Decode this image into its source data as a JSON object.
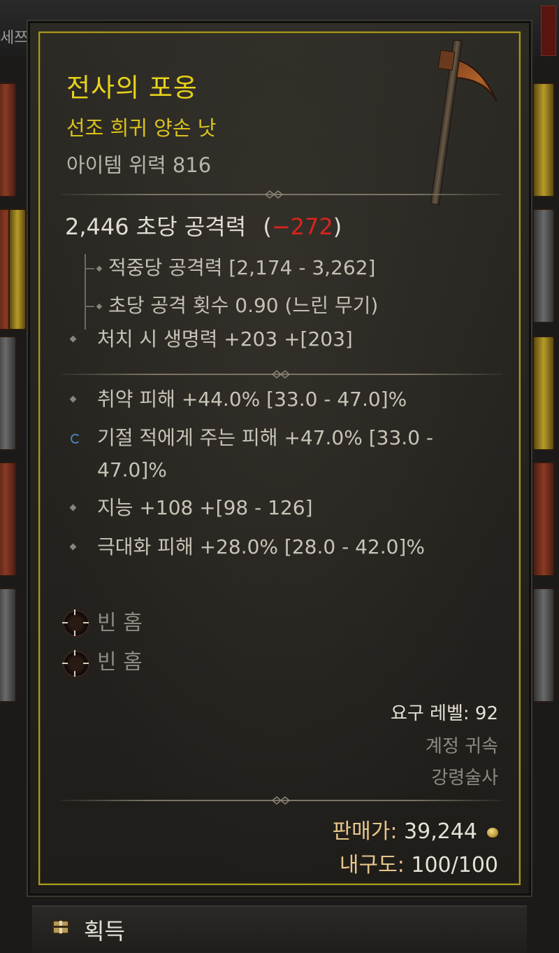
{
  "background": {
    "left_title": "세쯔"
  },
  "item": {
    "name": "전사의 포옹",
    "type": "선조 희귀 양손 낫",
    "item_power": "아이템 위력 816",
    "name_color": "#e7d21c"
  },
  "dps": {
    "label": "2,446 초당 공격력",
    "paren_open": "(",
    "delta": "−272",
    "paren_close": ")",
    "delta_color": "#d9241c"
  },
  "sub_stats": [
    {
      "text": "적중당 공격력 [2,174 - 3,262]"
    },
    {
      "text": "초당 공격 횟수 0.90 (느린 무기)"
    }
  ],
  "implicit": {
    "text": "처치 시 생명력 +203 +[203]"
  },
  "affixes": [
    {
      "text": "취약 피해 +44.0% [33.0 - 47.0]%",
      "icon": "diamond-bullet-icon"
    },
    {
      "text": "기절 적에게 주는 피해 +47.0% [33.0 - 47.0]%",
      "icon": "reroll-icon"
    },
    {
      "text": "지능 +108 +[98 - 126]",
      "icon": "diamond-bullet-icon"
    },
    {
      "text": "극대화 피해 +28.0% [28.0 - 42.0]%",
      "icon": "diamond-bullet-icon"
    }
  ],
  "sockets": [
    {
      "label": "빈 홈"
    },
    {
      "label": "빈 홈"
    }
  ],
  "requirements": {
    "level": "요구 레벨: 92",
    "bound": "계정 귀속",
    "class": "강령술사"
  },
  "sell": {
    "label": "판매가:",
    "value": "39,244"
  },
  "durability": {
    "label": "내구도:",
    "value": "100/100"
  },
  "bottom_bar": {
    "label": "획득"
  }
}
